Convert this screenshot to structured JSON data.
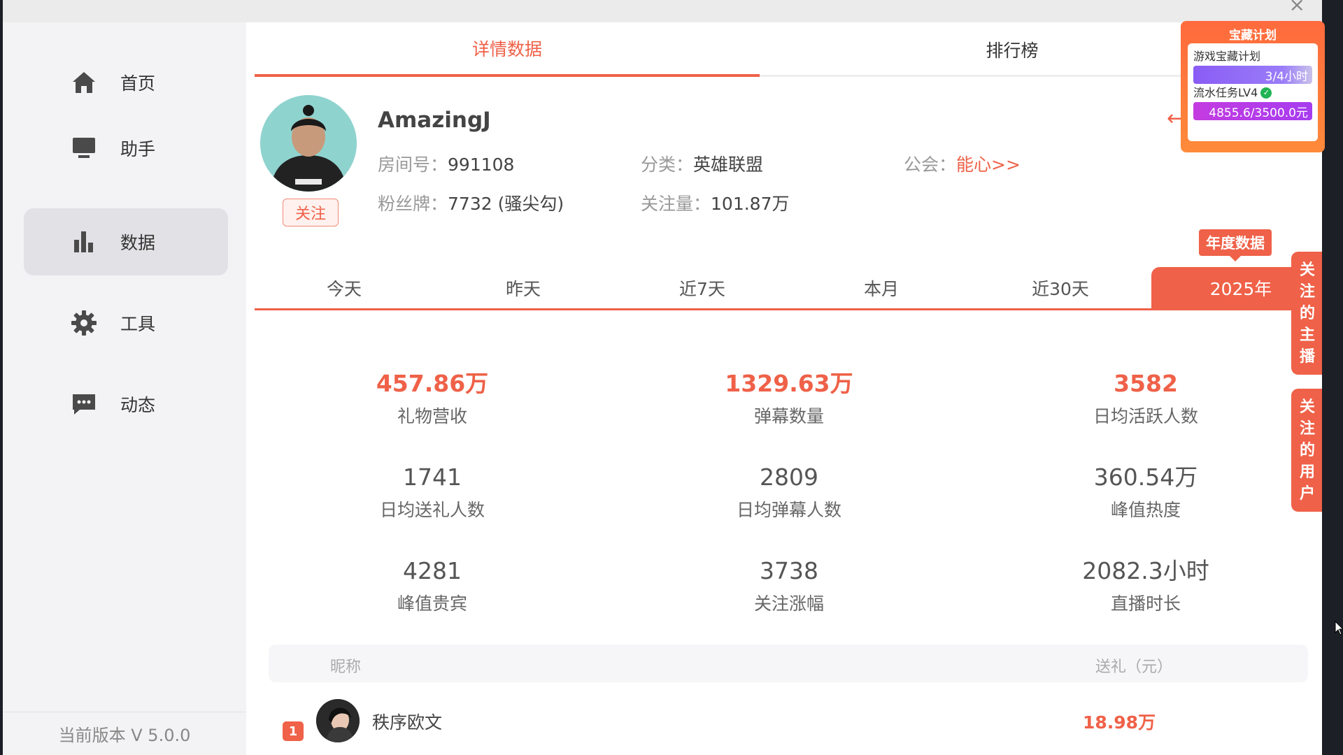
{
  "sidebar": {
    "items": [
      {
        "label": "首页",
        "icon": "home-icon"
      },
      {
        "label": "助手",
        "icon": "monitor-icon"
      },
      {
        "label": "数据",
        "icon": "bar-chart-icon",
        "active": true
      },
      {
        "label": "工具",
        "icon": "gear-icon"
      },
      {
        "label": "动态",
        "icon": "chat-icon"
      }
    ],
    "version": "当前版本 V 5.0.0"
  },
  "top_tabs": [
    {
      "label": "详情数据",
      "active": true
    },
    {
      "label": "排行榜",
      "active": false
    }
  ],
  "streamer": {
    "name": "AmazingJ",
    "follow_label": "关注",
    "room_key": "房间号：",
    "room_value": "991108",
    "category_key": "分类：",
    "category_value": "英雄联盟",
    "guild_key": "公会：",
    "guild_value": "能心>>",
    "fan_badge_key": "粉丝牌：",
    "fan_badge_value": "7732 (骚尖勾)",
    "followers_key": "关注量：",
    "followers_value": "101.87万"
  },
  "annual_badge": "年度数据",
  "period_tabs": [
    {
      "label": "今天",
      "active": false
    },
    {
      "label": "昨天",
      "active": false
    },
    {
      "label": "近7天",
      "active": false
    },
    {
      "label": "本月",
      "active": false
    },
    {
      "label": "近30天",
      "active": false
    },
    {
      "label": "2025年",
      "active": true
    }
  ],
  "stats": [
    {
      "value": "457.86万",
      "label": "礼物营收",
      "highlight": true
    },
    {
      "value": "1329.63万",
      "label": "弹幕数量",
      "highlight": true
    },
    {
      "value": "3582",
      "label": "日均活跃人数",
      "highlight": true
    },
    {
      "value": "1741",
      "label": "日均送礼人数",
      "highlight": false
    },
    {
      "value": "2809",
      "label": "日均弹幕人数",
      "highlight": false
    },
    {
      "value": "360.54万",
      "label": "峰值热度",
      "highlight": false
    },
    {
      "value": "4281",
      "label": "峰值贵宾",
      "highlight": false
    },
    {
      "value": "3738",
      "label": "关注涨幅",
      "highlight": false
    },
    {
      "value": "2082.3小时",
      "label": "直播时长",
      "highlight": false
    }
  ],
  "table": {
    "col_nick": "昵称",
    "col_gift": "送礼（元）",
    "rows": [
      {
        "rank": "1",
        "nick": "秩序欧文",
        "gift": "18.98万"
      }
    ]
  },
  "side_tabs": {
    "followed_streamers": [
      "关",
      "注",
      "的",
      "主",
      "播"
    ],
    "followed_users": [
      "关",
      "注",
      "的",
      "用",
      "户"
    ]
  },
  "treasure": {
    "title": "宝藏计划",
    "item1_label": "游戏宝藏计划",
    "item1_bar": "3/4小时",
    "item1_progress": 0.75,
    "item2_label": "流水任务LV4",
    "item2_bar": "4855.6/3500.0元",
    "item2_progress": 1.0
  },
  "colors": {
    "accent": "#ef6148",
    "treasure": "#ff6a3d",
    "bar_purple": "#8a5cf5",
    "bar_magenta": "#c43ce0"
  }
}
